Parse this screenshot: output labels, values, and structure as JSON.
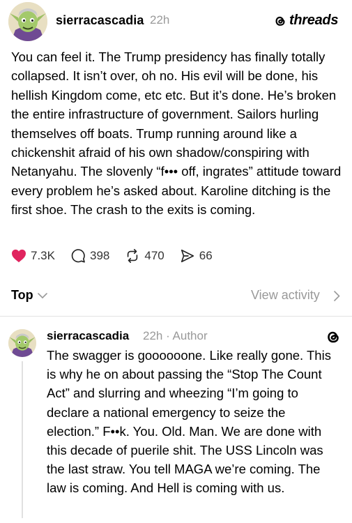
{
  "post": {
    "username": "sierracascadia",
    "time": "22h",
    "brand": "threads",
    "text": "You can feel it. The Trump presidency has finally totally collapsed. It isn’t over, oh no. His evil will be done, his hellish Kingdom come, etc etc. But it’s done. He’s  broken the entire infrastructure of government. Sailors hurling themselves off boats. Trump running around like a chickenshit afraid of his own shadow/conspiring with Netanyahu. The slovenly “f••• off, ingrates” attitude toward every problem he’s asked about. Karoline ditching is the first shoe. The crash to the exits is coming.",
    "stats": {
      "likes": "7.3K",
      "replies": "398",
      "reposts": "470",
      "shares": "66"
    },
    "liked": true,
    "like_color": "#e0245e"
  },
  "sort": {
    "label": "Top",
    "view_activity": "View activity"
  },
  "reply": {
    "username": "sierracascadia",
    "meta": "22h · Author",
    "text": "The swagger is goooooone. Like really gone. This is why he on about passing the “Stop The Count Act” and slurring and wheezing “I’m going to declare a national emergency to seize the election.” F••k. You. Old. Man. We are done with this decade of puerile shit. The USS Lincoln was the last straw. You tell MAGA we’re coming. The law is coming. And Hell is coming with us."
  },
  "icons": {
    "avatar": "goblin-avatar",
    "brand": "threads-logo-icon",
    "like": "heart-icon",
    "reply": "speech-bubble-icon",
    "repost": "repost-icon",
    "share": "send-icon"
  }
}
